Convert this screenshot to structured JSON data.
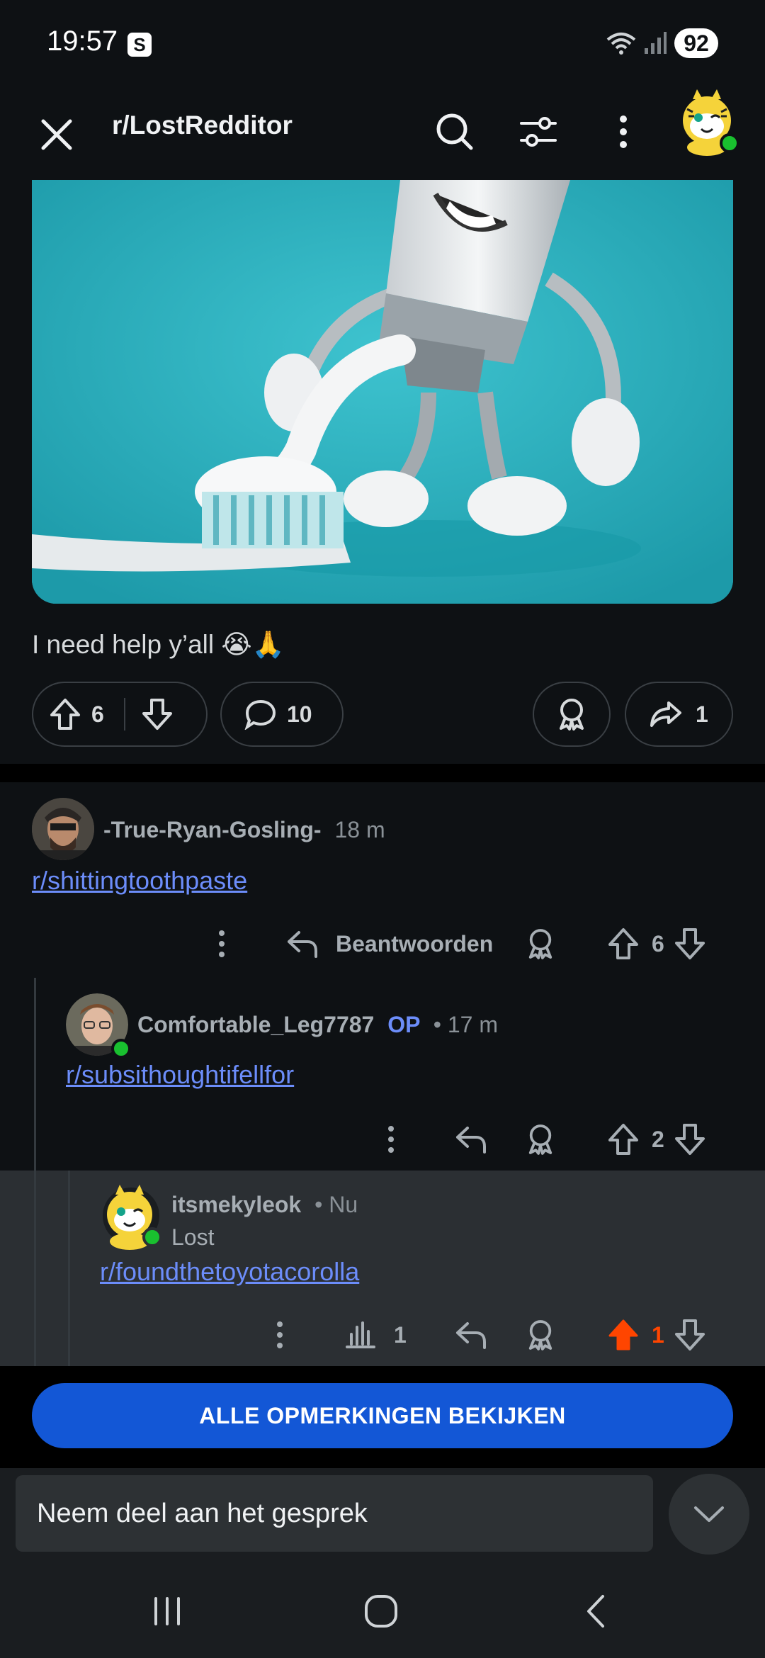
{
  "status_bar": {
    "time": "19:57",
    "s_badge": "S",
    "battery": "92"
  },
  "header": {
    "subreddit": "r/LostRedditor"
  },
  "post": {
    "body": "I need help y’all 😭🙏",
    "upvotes": "6",
    "comments": "10",
    "shares": "1"
  },
  "comments": [
    {
      "author": "-True-Ryan-Gosling-",
      "time": "18 m",
      "link": "r/shittingtoothpaste",
      "reply_label": "Beantwoorden",
      "votes": "6"
    },
    {
      "author": "Comfortable_Leg7787",
      "op": "OP",
      "time": "• 17 m",
      "link": "r/subsithoughtifellfor",
      "votes": "2"
    },
    {
      "author": "itsmekyleok",
      "time": "• Nu",
      "flair": "Lost",
      "link": "r/foundthetoyotacorolla",
      "views": "1",
      "votes": "1"
    }
  ],
  "view_all_label": "ALLE OPMERKINGEN BEKIJKEN",
  "join_placeholder": "Neem deel aan het gesprek",
  "colors": {
    "upvote_active": "#ff4500",
    "link": "#6c8dfa",
    "button": "#1357d6"
  }
}
